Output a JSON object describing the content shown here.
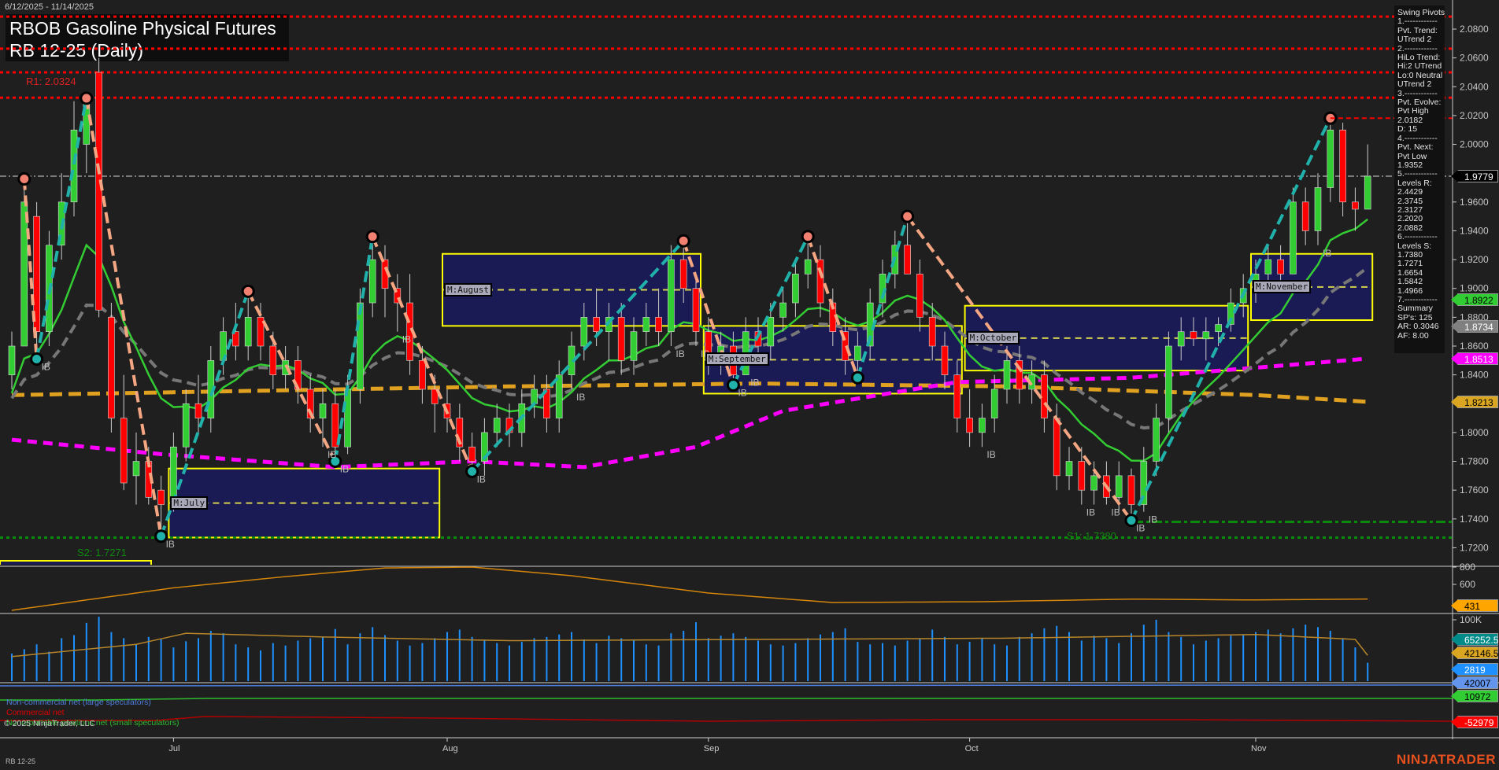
{
  "header": {
    "date_range": "6/12/2025 - 11/14/2025",
    "title_line1": "RBOB Gasoline Physical Futures",
    "title_line2": "RB 12-25 (Daily)"
  },
  "swing_pivots": {
    "lines": [
      "Swing Pivots",
      "1.------------",
      "Pvt. Trend:",
      "UTrend 2",
      "2.------------",
      "HiLo Trend:",
      "Hi:2 UTrend",
      "Lo:0 Neutral",
      "UTrend 2",
      "3.------------",
      "Pvt. Evolve:",
      "Pvt High",
      "2.0182",
      "D: 15",
      "4.------------",
      "Pvt. Next:",
      "Pvt Low",
      "1.9352",
      "5.------------",
      "Levels R:",
      "2.4429",
      "2.3745",
      "2.3127",
      "2.2020",
      "2.0882",
      "6.------------",
      "Levels S:",
      "1.7380",
      "1.7271",
      "1.6654",
      "1.5842",
      "1.4966",
      "7.------------",
      "Summary",
      "SP's: 125",
      "AR: 0.3046",
      "AF: 8.00"
    ]
  },
  "labels": {
    "r1": "R1: 2.0324",
    "s1": "S1: 1.7380",
    "s2": "S2: 1.7271",
    "ib": "IB"
  },
  "month_boxes": [
    {
      "label": "M:July",
      "start": 13,
      "end": 34,
      "high": 1.775,
      "low": 1.7271
    },
    {
      "label": "M:August",
      "start": 35,
      "end": 55,
      "high": 1.924,
      "low": 1.874
    },
    {
      "label": "M:September",
      "start": 56,
      "end": 76,
      "high": 1.874,
      "low": 1.827
    },
    {
      "label": "M:October",
      "start": 77,
      "end": 99,
      "high": 1.888,
      "low": 1.843
    },
    {
      "label": "M:November",
      "start": 100,
      "end": 109,
      "high": 1.924,
      "low": 1.878
    }
  ],
  "flags": [
    {
      "value": "1.9779",
      "bg": "#000000",
      "fg": "#ffffff"
    },
    {
      "value": "1.8922",
      "bg": "#32cd32",
      "fg": "#000000"
    },
    {
      "value": "1.8734",
      "bg": "#808080",
      "fg": "#ffffff"
    },
    {
      "value": "1.8513",
      "bg": "#ff00ff",
      "fg": "#ffffff"
    },
    {
      "value": "1.8213",
      "bg": "#daa520",
      "fg": "#000000"
    }
  ],
  "lower_flags": [
    {
      "value": "431",
      "bg": "#ffa500",
      "fg": "#000000",
      "panel": "osc"
    },
    {
      "value": "65252.53",
      "bg": "#008b8b",
      "fg": "#ffffff",
      "panel": "vol"
    },
    {
      "value": "42146.52",
      "bg": "#daa520",
      "fg": "#000000",
      "panel": "vol"
    },
    {
      "value": "2819",
      "bg": "#1e90ff",
      "fg": "#ffffff",
      "panel": "cot"
    },
    {
      "value": "42007",
      "bg": "#6495ed",
      "fg": "#000000",
      "panel": "cot"
    },
    {
      "value": "10972",
      "bg": "#32cd32",
      "fg": "#000000",
      "panel": "cot"
    },
    {
      "value": "-52979",
      "bg": "#ff0000",
      "fg": "#ffffff",
      "panel": "cot"
    }
  ],
  "cot_legend": [
    {
      "text": "Non-commercial net (large speculators)",
      "color": "#4f7fe0"
    },
    {
      "text": "Commercial net",
      "color": "#e00000"
    },
    {
      "text": "Nonreportable positions net (small speculators)",
      "color": "#2db82d"
    }
  ],
  "copyright": "© 2025 NinjaTrader, LLC",
  "footer": "RB 12-25",
  "logo": "NINJATRADER",
  "chart_data": {
    "type": "candlestick",
    "title": "RBOB Gasoline Physical Futures RB 12-25 (Daily)",
    "ylim": [
      1.71,
      2.09
    ],
    "y_ticks": [
      "2.0800",
      "2.0600",
      "2.0400",
      "2.0200",
      "2.0000",
      "1.9600",
      "1.9400",
      "1.9200",
      "1.9000",
      "1.8800",
      "1.8600",
      "1.8400",
      "1.8000",
      "1.7800",
      "1.7600",
      "1.7400",
      "1.7200"
    ],
    "x_ticks": [
      {
        "label": "Jul",
        "bar": 13
      },
      {
        "label": "Aug",
        "bar": 35
      },
      {
        "label": "Sep",
        "bar": 56
      },
      {
        "label": "Oct",
        "bar": 77
      },
      {
        "label": "Nov",
        "bar": 100
      }
    ],
    "current_price": 1.9779,
    "resistance_lines": [
      2.0887,
      2.0664,
      2.05,
      2.0324
    ],
    "support_lines": [
      1.738,
      1.7271
    ],
    "ohlc": [
      [
        1.84,
        1.87,
        1.83,
        1.86
      ],
      [
        1.86,
        1.976,
        1.86,
        1.96
      ],
      [
        1.95,
        1.96,
        1.851,
        1.87
      ],
      [
        1.87,
        1.94,
        1.86,
        1.93
      ],
      [
        1.93,
        1.98,
        1.92,
        1.96
      ],
      [
        1.96,
        2.03,
        1.95,
        2.01
      ],
      [
        2.0,
        2.032,
        1.98,
        2.03
      ],
      [
        2.05,
        2.06,
        1.88,
        1.885
      ],
      [
        1.88,
        1.89,
        1.8,
        1.81
      ],
      [
        1.81,
        1.84,
        1.76,
        1.765
      ],
      [
        1.77,
        1.8,
        1.75,
        1.78
      ],
      [
        1.78,
        1.79,
        1.75,
        1.755
      ],
      [
        1.76,
        1.77,
        1.728,
        1.75
      ],
      [
        1.75,
        1.8,
        1.745,
        1.79
      ],
      [
        1.79,
        1.83,
        1.78,
        1.82
      ],
      [
        1.82,
        1.84,
        1.8,
        1.81
      ],
      [
        1.81,
        1.86,
        1.8,
        1.85
      ],
      [
        1.85,
        1.88,
        1.84,
        1.87
      ],
      [
        1.87,
        1.89,
        1.85,
        1.86
      ],
      [
        1.86,
        1.898,
        1.85,
        1.88
      ],
      [
        1.88,
        1.89,
        1.85,
        1.86
      ],
      [
        1.86,
        1.87,
        1.83,
        1.84
      ],
      [
        1.84,
        1.86,
        1.83,
        1.85
      ],
      [
        1.85,
        1.86,
        1.82,
        1.83
      ],
      [
        1.83,
        1.84,
        1.8,
        1.81
      ],
      [
        1.81,
        1.83,
        1.79,
        1.82
      ],
      [
        1.82,
        1.83,
        1.78,
        1.79
      ],
      [
        1.79,
        1.84,
        1.785,
        1.83
      ],
      [
        1.83,
        1.9,
        1.82,
        1.89
      ],
      [
        1.89,
        1.936,
        1.88,
        1.92
      ],
      [
        1.92,
        1.93,
        1.88,
        1.9
      ],
      [
        1.9,
        1.91,
        1.87,
        1.89
      ],
      [
        1.89,
        1.91,
        1.84,
        1.85
      ],
      [
        1.85,
        1.86,
        1.82,
        1.83
      ],
      [
        1.83,
        1.84,
        1.8,
        1.82
      ],
      [
        1.82,
        1.83,
        1.8,
        1.81
      ],
      [
        1.81,
        1.82,
        1.78,
        1.79
      ],
      [
        1.79,
        1.8,
        1.773,
        1.78
      ],
      [
        1.78,
        1.81,
        1.77,
        1.8
      ],
      [
        1.8,
        1.82,
        1.79,
        1.81
      ],
      [
        1.81,
        1.82,
        1.79,
        1.8
      ],
      [
        1.8,
        1.83,
        1.79,
        1.82
      ],
      [
        1.82,
        1.84,
        1.81,
        1.83
      ],
      [
        1.83,
        1.84,
        1.8,
        1.81
      ],
      [
        1.81,
        1.85,
        1.8,
        1.84
      ],
      [
        1.84,
        1.87,
        1.83,
        1.86
      ],
      [
        1.86,
        1.89,
        1.85,
        1.88
      ],
      [
        1.88,
        1.9,
        1.86,
        1.87
      ],
      [
        1.87,
        1.89,
        1.85,
        1.88
      ],
      [
        1.88,
        1.89,
        1.84,
        1.85
      ],
      [
        1.85,
        1.88,
        1.84,
        1.87
      ],
      [
        1.87,
        1.89,
        1.86,
        1.88
      ],
      [
        1.88,
        1.9,
        1.86,
        1.87
      ],
      [
        1.87,
        1.93,
        1.86,
        1.92
      ],
      [
        1.92,
        1.933,
        1.89,
        1.9
      ],
      [
        1.9,
        1.91,
        1.86,
        1.87
      ],
      [
        1.87,
        1.88,
        1.84,
        1.85
      ],
      [
        1.85,
        1.87,
        1.84,
        1.86
      ],
      [
        1.86,
        1.87,
        1.833,
        1.84
      ],
      [
        1.84,
        1.88,
        1.84,
        1.87
      ],
      [
        1.87,
        1.88,
        1.85,
        1.86
      ],
      [
        1.86,
        1.89,
        1.85,
        1.88
      ],
      [
        1.88,
        1.9,
        1.87,
        1.89
      ],
      [
        1.89,
        1.92,
        1.88,
        1.91
      ],
      [
        1.91,
        1.936,
        1.9,
        1.92
      ],
      [
        1.92,
        1.93,
        1.88,
        1.89
      ],
      [
        1.89,
        1.9,
        1.86,
        1.87
      ],
      [
        1.87,
        1.88,
        1.84,
        1.85
      ],
      [
        1.85,
        1.87,
        1.838,
        1.86
      ],
      [
        1.86,
        1.9,
        1.85,
        1.89
      ],
      [
        1.89,
        1.92,
        1.88,
        1.91
      ],
      [
        1.91,
        1.94,
        1.9,
        1.93
      ],
      [
        1.93,
        1.95,
        1.91,
        1.91
      ],
      [
        1.91,
        1.92,
        1.87,
        1.88
      ],
      [
        1.88,
        1.89,
        1.85,
        1.86
      ],
      [
        1.86,
        1.87,
        1.83,
        1.84
      ],
      [
        1.84,
        1.85,
        1.8,
        1.81
      ],
      [
        1.81,
        1.83,
        1.79,
        1.8
      ],
      [
        1.8,
        1.82,
        1.79,
        1.81
      ],
      [
        1.81,
        1.84,
        1.8,
        1.83
      ],
      [
        1.83,
        1.86,
        1.82,
        1.85
      ],
      [
        1.85,
        1.86,
        1.82,
        1.83
      ],
      [
        1.83,
        1.85,
        1.82,
        1.84
      ],
      [
        1.84,
        1.85,
        1.8,
        1.81
      ],
      [
        1.81,
        1.82,
        1.76,
        1.77
      ],
      [
        1.77,
        1.79,
        1.76,
        1.78
      ],
      [
        1.78,
        1.79,
        1.75,
        1.76
      ],
      [
        1.76,
        1.78,
        1.75,
        1.77
      ],
      [
        1.77,
        1.78,
        1.75,
        1.755
      ],
      [
        1.755,
        1.78,
        1.745,
        1.77
      ],
      [
        1.77,
        1.775,
        1.739,
        1.75
      ],
      [
        1.75,
        1.79,
        1.745,
        1.78
      ],
      [
        1.78,
        1.82,
        1.77,
        1.81
      ],
      [
        1.81,
        1.87,
        1.8,
        1.86
      ],
      [
        1.86,
        1.88,
        1.85,
        1.87
      ],
      [
        1.87,
        1.88,
        1.86,
        1.865
      ],
      [
        1.865,
        1.88,
        1.85,
        1.87
      ],
      [
        1.87,
        1.88,
        1.86,
        1.875
      ],
      [
        1.875,
        1.9,
        1.87,
        1.89
      ],
      [
        1.89,
        1.91,
        1.88,
        1.9
      ],
      [
        1.9,
        1.92,
        1.89,
        1.91
      ],
      [
        1.91,
        1.93,
        1.9,
        1.92
      ],
      [
        1.92,
        1.93,
        1.9,
        1.91
      ],
      [
        1.91,
        1.97,
        1.91,
        1.96
      ],
      [
        1.96,
        1.97,
        1.93,
        1.94
      ],
      [
        1.94,
        1.98,
        1.93,
        1.97
      ],
      [
        1.97,
        2.0182,
        1.96,
        2.01
      ],
      [
        2.01,
        2.015,
        1.95,
        1.96
      ],
      [
        1.96,
        1.97,
        1.94,
        1.955
      ],
      [
        1.955,
        2.0,
        1.955,
        1.9779
      ]
    ],
    "swing_pivots": [
      [
        1,
        "H"
      ],
      [
        2,
        "L"
      ],
      [
        6,
        "H"
      ],
      [
        12,
        "L"
      ],
      [
        19,
        "H"
      ],
      [
        26,
        "L"
      ],
      [
        29,
        "H"
      ],
      [
        37,
        "L"
      ],
      [
        54,
        "H"
      ],
      [
        58,
        "L"
      ],
      [
        64,
        "H"
      ],
      [
        68,
        "L"
      ],
      [
        72,
        "H"
      ],
      [
        90,
        "L"
      ],
      [
        106,
        "H"
      ]
    ],
    "ib_bars": [
      2,
      12,
      25,
      26,
      31,
      37,
      45,
      53,
      55,
      58,
      59,
      78,
      86,
      88,
      90,
      91,
      105
    ],
    "ma_orange": [
      [
        0,
        1.826
      ],
      [
        20,
        1.829
      ],
      [
        40,
        1.832
      ],
      [
        60,
        1.834
      ],
      [
        80,
        1.832
      ],
      [
        100,
        1.826
      ],
      [
        109,
        1.8213
      ]
    ],
    "ma_magenta": [
      [
        0,
        1.795
      ],
      [
        12,
        1.785
      ],
      [
        26,
        1.776
      ],
      [
        37,
        1.78
      ],
      [
        46,
        1.776
      ],
      [
        55,
        1.79
      ],
      [
        62,
        1.815
      ],
      [
        76,
        1.835
      ],
      [
        90,
        1.838
      ],
      [
        100,
        1.845
      ],
      [
        109,
        1.8513
      ]
    ],
    "oscillator": {
      "ticks": [
        "800",
        "600"
      ],
      "points": [
        [
          0,
          300
        ],
        [
          6,
          420
        ],
        [
          13,
          560
        ],
        [
          22,
          690
        ],
        [
          30,
          790
        ],
        [
          37,
          800
        ],
        [
          45,
          700
        ],
        [
          56,
          500
        ],
        [
          66,
          390
        ],
        [
          78,
          400
        ],
        [
          90,
          430
        ],
        [
          100,
          420
        ],
        [
          109,
          431
        ]
      ]
    },
    "volume": {
      "tick": "100K",
      "values": [
        45,
        52,
        60,
        48,
        70,
        75,
        95,
        105,
        80,
        70,
        60,
        72,
        68,
        55,
        65,
        70,
        82,
        78,
        60,
        55,
        50,
        62,
        58,
        66,
        70,
        72,
        85,
        60,
        78,
        88,
        75,
        66,
        58,
        62,
        70,
        80,
        84,
        72,
        66,
        62,
        58,
        64,
        70,
        72,
        76,
        80,
        68,
        62,
        74,
        70,
        66,
        60,
        58,
        78,
        82,
        96,
        70,
        74,
        78,
        72,
        66,
        60,
        58,
        62,
        70,
        76,
        80,
        86,
        64,
        60,
        62,
        58,
        66,
        70,
        84,
        72,
        60,
        64,
        70,
        60,
        58,
        72,
        78,
        86,
        90,
        80,
        66,
        74,
        70,
        62,
        78,
        92,
        100,
        80,
        72,
        60,
        66,
        70,
        74,
        76,
        80,
        84,
        78,
        86,
        92,
        88,
        82,
        70,
        55,
        30
      ],
      "avg_line": [
        [
          0,
          40
        ],
        [
          10,
          60
        ],
        [
          14,
          78
        ],
        [
          25,
          72
        ],
        [
          40,
          66
        ],
        [
          60,
          68
        ],
        [
          80,
          70
        ],
        [
          100,
          76
        ],
        [
          108,
          68
        ],
        [
          109,
          42
        ]
      ]
    },
    "cot": {
      "noncommercial": 42007,
      "commercial": -52979,
      "nonreportable": 10972
    }
  }
}
